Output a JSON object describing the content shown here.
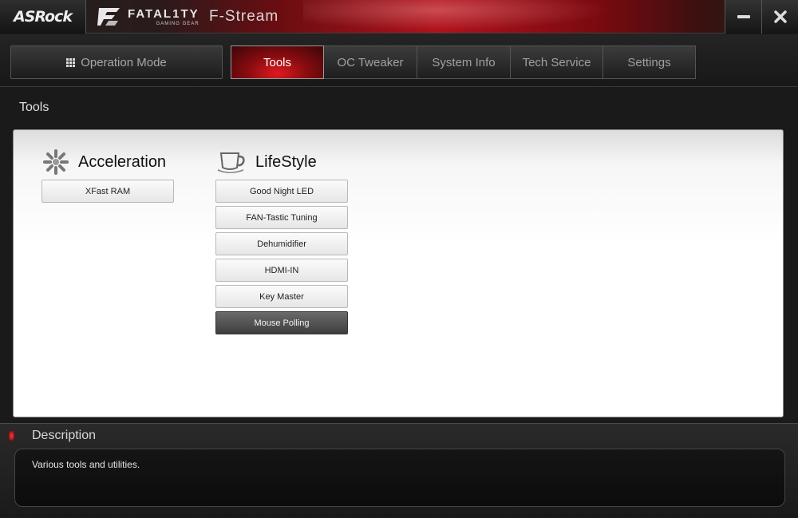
{
  "titlebar": {
    "brand": "ASRock",
    "fatal_word": "FATAL1TY",
    "fatal_sub": "GAMING GEAR",
    "app_name": "F-Stream",
    "minimize_icon": "minimize-icon",
    "close_icon": "close-icon"
  },
  "nav": {
    "operation_mode": "Operation Mode",
    "tabs": [
      {
        "label": "Tools",
        "active": true
      },
      {
        "label": "OC Tweaker",
        "active": false
      },
      {
        "label": "System Info",
        "active": false
      },
      {
        "label": "Tech Service",
        "active": false
      },
      {
        "label": "Settings",
        "active": false
      }
    ]
  },
  "page": {
    "section_title": "Tools"
  },
  "groups": {
    "acceleration": {
      "title": "Acceleration",
      "icon": "acceleration-icon",
      "buttons": [
        "XFast RAM"
      ]
    },
    "lifestyle": {
      "title": "LifeStyle",
      "icon": "coffee-cup-icon",
      "buttons": [
        "Good Night LED",
        "FAN-Tastic Tuning",
        "Dehumidifier",
        "HDMI-IN",
        "Key Master",
        "Mouse Polling"
      ],
      "selected": "Mouse Polling"
    }
  },
  "description": {
    "title": "Description",
    "text": "Various tools and utilities."
  },
  "colors": {
    "accent_red": "#b0121c",
    "active_tab_red": "#e01a20",
    "panel_bg": "#ffffff",
    "selected_button": "#4e4e4e"
  }
}
